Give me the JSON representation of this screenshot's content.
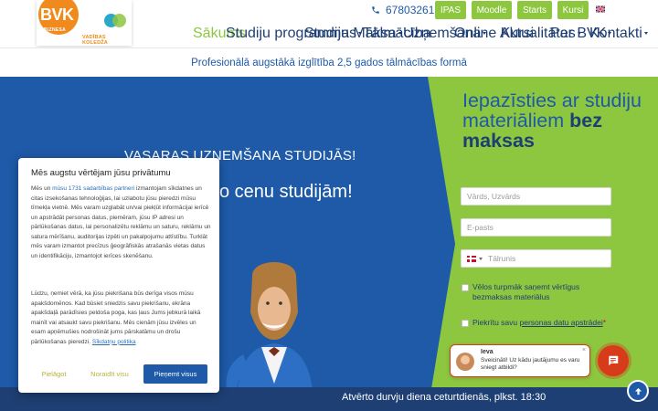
{
  "header": {
    "logo": {
      "name": "BVK",
      "subtitle": "BIZNESA",
      "tag": "VADĪBAS KOLEDŽA"
    },
    "phone": "67803261",
    "quick_links": [
      "IPAS",
      "Moodle",
      "Starts",
      "Kursi"
    ],
    "nav": [
      {
        "label": "Sākums",
        "dropdown": false,
        "active": true
      },
      {
        "label": "Studiju programmas",
        "dropdown": true,
        "active": false
      },
      {
        "label": "Studiju Maksa",
        "dropdown": true,
        "active": false
      },
      {
        "label": "Tālmācība",
        "dropdown": false,
        "active": false
      },
      {
        "label": "Uzņemšana",
        "dropdown": true,
        "active": false
      },
      {
        "label": "Online Kursi",
        "dropdown": false,
        "active": false
      },
      {
        "label": "Aktualitātes",
        "dropdown": true,
        "active": false
      },
      {
        "label": "Par BVK",
        "dropdown": true,
        "active": false
      },
      {
        "label": "Kontakti",
        "dropdown": true,
        "active": false
      }
    ]
  },
  "tagline": "Profesionālā augstākā izglītība 2,5 gados tālmācības formā",
  "hero": {
    "subheading": "VASARAS UZŅEMŠANA STUDIJĀS!",
    "heading_fragment": "ko cenu studijām!"
  },
  "form": {
    "title_regular": "Iepazīsties ar studiju materiāliem",
    "title_bold": "bez maksas",
    "name_placeholder": "Vārds, Uzvārds",
    "email_placeholder": "E-pasts",
    "phone_placeholder": "Tālrunis",
    "checkbox_marketing": "Vēlos turpmāk saņemt vērtīgus bezmaksas materiālus",
    "checkbox_privacy_prefix": "Piekrītu savu",
    "checkbox_privacy_link": "personas datu apstrādei",
    "checkbox_privacy_required": "*"
  },
  "chat": {
    "agent_name": "Ieva",
    "message": "Sveicināti! Uz kādu jautājumu es varu sniegt atbildi?",
    "close": "×"
  },
  "bottom_bar": {
    "text": "Atvērto durvju diena ceturtdienās, plkst. 18:30"
  },
  "cookie": {
    "title": "Mēs augstu vērtējam jūsu privātumu",
    "p1_a": "Mēs un",
    "p1_link": "mūsu 1731 sadarbības partneri",
    "p1_b": "izmantojam sīkdatnes un citas izsekošanas tehnoloģijas, lai uzlabotu jūsu pieredzi mūsu tīmekļa vietnē. Mēs varam uzglabāt un/vai piekļūt informācijai ierīcē un apstrādāt personas datus, piemēram, jūsu IP adresi un pārlūkošanas datus, lai personalizētu reklāmu un saturu, reklāmu un satura mērīšanu, auditorijas izpēti un pakalpojumu attīstību. Turklāt mēs varam izmantot precīzus ģeogrāfiskās atrašanās vietas datus un identifikāciju, izmantojot ierīces skenēšanu.",
    "p2": "Lūdzu, ņemiet vērā, ka jūsu piekrišana būs derīga visos mūsu apakšdomēnos. Kad būsiet sniedzis savu piekrišanu, ekrāna apakšdaļā parādīsies peldoša poga, kas ļaus Jums jebkurā laikā mainīt vai atsaukt savu piekrišanu. Mēs cienām jūsu izvēles un esam apņēmušies nodrošināt jums pārskatāmu un drošu pārlūkošanas pieredzi.",
    "p2_link": "Sīkdatņu politika",
    "btn_customize": "Pielāgot",
    "btn_reject": "Noraidīt visu",
    "btn_accept": "Pieņemt visus"
  },
  "colors": {
    "brand_blue": "#1e5aa8",
    "navy": "#1e3f73",
    "brand_green": "#8dc63f",
    "orange": "#f08a1c",
    "chat_red": "#d73c1a"
  }
}
